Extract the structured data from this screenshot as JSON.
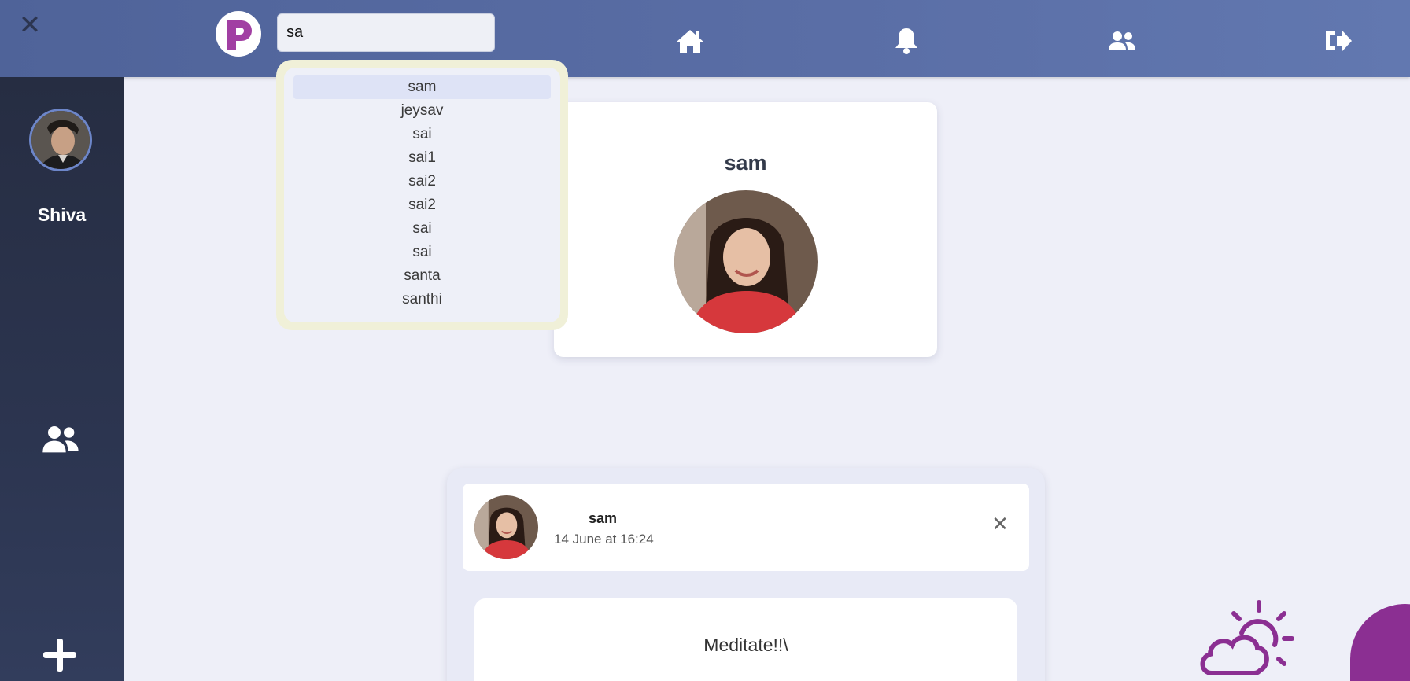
{
  "topbar": {
    "close_label": "✕",
    "search": {
      "value": "sa",
      "placeholder": ""
    }
  },
  "sidebar": {
    "user_name": "Shiva"
  },
  "suggestions": [
    "sam",
    "jeysav",
    "sai",
    "sai1",
    "sai2",
    "sai2",
    "sai",
    "sai",
    "santa",
    "santhi"
  ],
  "profile": {
    "name": "sam"
  },
  "post": {
    "user": "sam",
    "timestamp": "14 June at 16:24",
    "close_label": "✕",
    "text": "Meditate!!\\"
  },
  "colors": {
    "topbar": "#5a6ea6",
    "sidebar": "#2c3550",
    "accent_purple": "#8b2f92",
    "background": "#eeeff8"
  },
  "icons": {
    "nav": [
      "home-icon",
      "bell-icon",
      "friends-icon",
      "logout-icon"
    ],
    "sidebar": [
      "friends-icon",
      "plus-icon"
    ],
    "decor": [
      "weather-cloud-sun-icon"
    ]
  }
}
